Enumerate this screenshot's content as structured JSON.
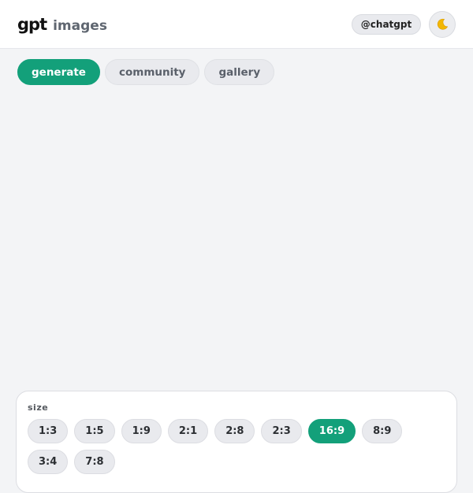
{
  "header": {
    "logo_main": "gpt",
    "logo_sub": "images",
    "handle": "@chatgpt",
    "theme_icon": "moon-icon"
  },
  "tabs": [
    {
      "label": "generate",
      "active": true
    },
    {
      "label": "community",
      "active": false
    },
    {
      "label": "gallery",
      "active": false
    }
  ],
  "size_panel": {
    "label": "size",
    "options": [
      "1:3",
      "1:5",
      "1:9",
      "2:1",
      "2:8",
      "2:3",
      "16:9",
      "8:9",
      "3:4",
      "7:8"
    ],
    "selected": "16:9"
  },
  "colors": {
    "accent": "#13a07a",
    "background": "#f3f4f6"
  }
}
